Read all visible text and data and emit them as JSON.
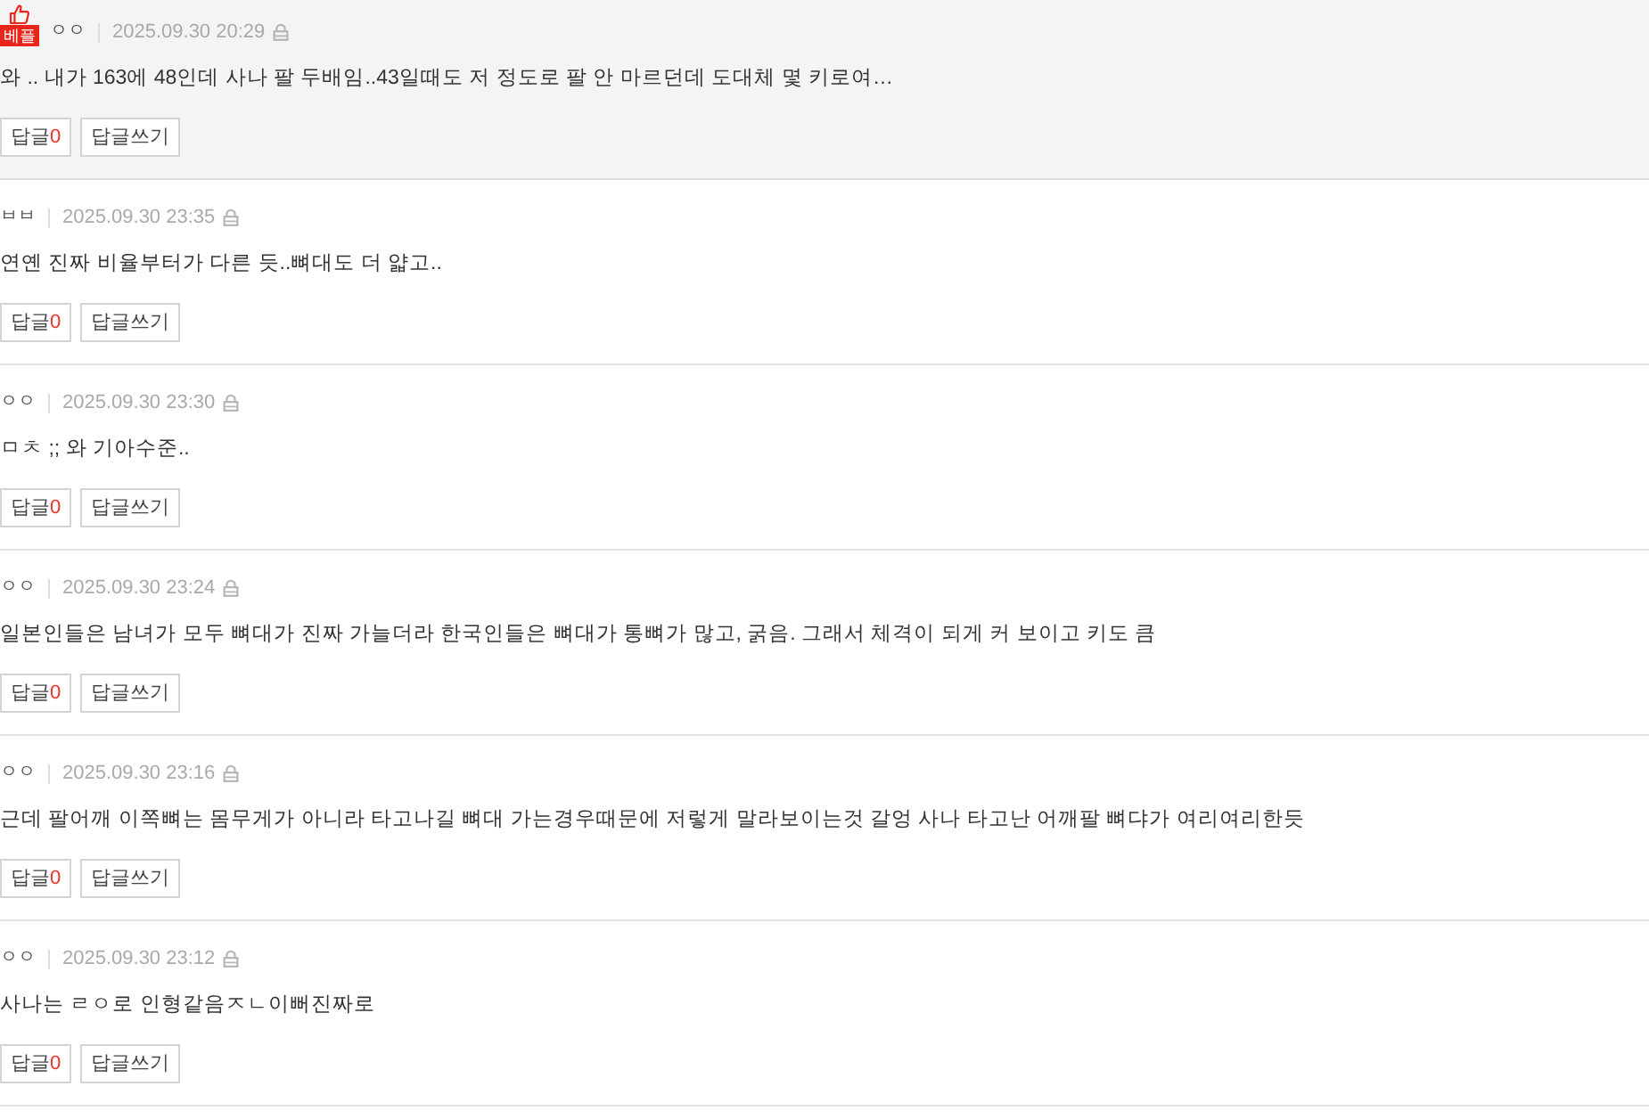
{
  "comments": [
    {
      "best": true,
      "badge": "베플",
      "author": "ㅇㅇ",
      "date": "2025.09.30 20:29",
      "text": "와 .. 내가 163에 48인데 사나 팔 두배임..43일때도 저 정도로 팔 안 마르던데 도대체 몇 키로여…",
      "reply_button": {
        "label": "답글",
        "count": "0"
      },
      "write_button": "답글쓰기"
    },
    {
      "best": false,
      "author": "ㅂㅂ",
      "date": "2025.09.30 23:35",
      "text": "연옌 진짜 비율부터가 다른 듯..뼈대도 더 얇고..",
      "reply_button": {
        "label": "답글",
        "count": "0"
      },
      "write_button": "답글쓰기"
    },
    {
      "best": false,
      "author": "ㅇㅇ",
      "date": "2025.09.30 23:30",
      "text": "ㅁㅊ ;; 와 기아수준..",
      "reply_button": {
        "label": "답글",
        "count": "0"
      },
      "write_button": "답글쓰기"
    },
    {
      "best": false,
      "author": "ㅇㅇ",
      "date": "2025.09.30 23:24",
      "text": "일본인들은 남녀가 모두 뼈대가 진짜 가늘더라 한국인들은 뼈대가 통뼈가 많고, 굵음. 그래서 체격이 되게 커 보이고 키도 큼",
      "reply_button": {
        "label": "답글",
        "count": "0"
      },
      "write_button": "답글쓰기"
    },
    {
      "best": false,
      "author": "ㅇㅇ",
      "date": "2025.09.30 23:16",
      "text": "근데 팔어깨 이쪽뼈는 몸무게가 아니라 타고나길 뼈대 가는경우때문에 저렇게 말라보이는것 갈엉 사나 타고난 어깨팔 뼈댜가 여리여리한듯",
      "reply_button": {
        "label": "답글",
        "count": "0"
      },
      "write_button": "답글쓰기"
    },
    {
      "best": false,
      "author": "ㅇㅇ",
      "date": "2025.09.30 23:12",
      "text": "사나는 ㄹㅇ로 인형같음ㅈㄴ이뻐진짜로",
      "reply_button": {
        "label": "답글",
        "count": "0"
      },
      "write_button": "답글쓰기"
    }
  ]
}
